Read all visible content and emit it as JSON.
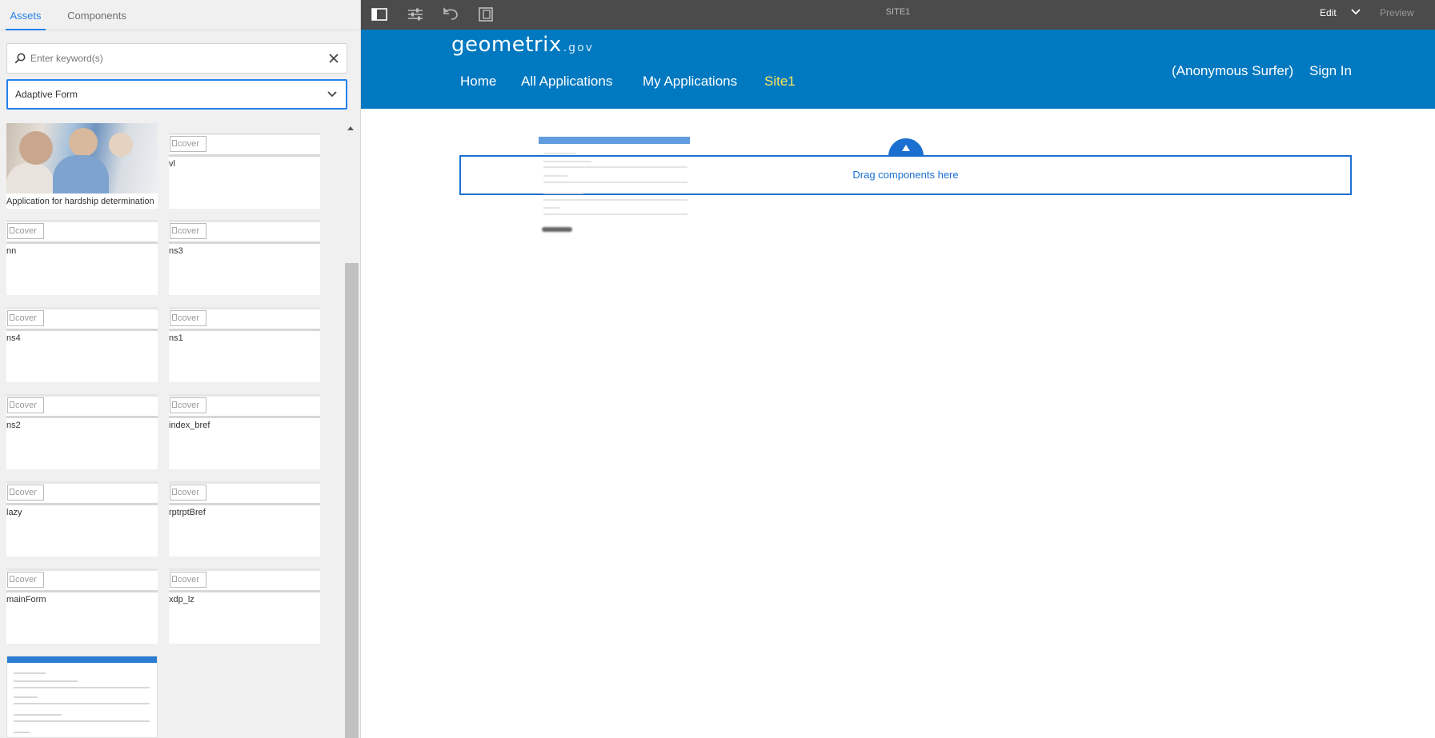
{
  "rail": {
    "tabs": [
      {
        "label": "Assets",
        "active": true
      },
      {
        "label": "Components",
        "active": false
      }
    ],
    "search": {
      "placeholder": "Enter keyword(s)",
      "value": ""
    },
    "filter": {
      "selected": "Adaptive Form"
    },
    "assets": [
      {
        "label": "Application for hardship determination",
        "thumbnail": "photo"
      },
      {
        "label": "vl",
        "cover_alt": "cover"
      },
      {
        "label": "nn",
        "cover_alt": "cover"
      },
      {
        "label": "ns3",
        "cover_alt": "cover"
      },
      {
        "label": "ns4",
        "cover_alt": "cover"
      },
      {
        "label": "ns1",
        "cover_alt": "cover"
      },
      {
        "label": "ns2",
        "cover_alt": "cover"
      },
      {
        "label": "index_bref",
        "cover_alt": "cover"
      },
      {
        "label": "lazy",
        "cover_alt": "cover"
      },
      {
        "label": "rptrptBref",
        "cover_alt": "cover"
      },
      {
        "label": "mainForm",
        "cover_alt": "cover"
      },
      {
        "label": "xdp_lz",
        "cover_alt": "cover"
      }
    ]
  },
  "toolbar": {
    "title": "SITE1",
    "mode": "Edit",
    "preview": "Preview",
    "icons": [
      "toggle-side-panel-icon",
      "page-properties-icon",
      "undo-icon",
      "emulator-icon"
    ]
  },
  "site": {
    "logo": "geometrix",
    "logo_suffix": ".gov",
    "nav": [
      {
        "label": "Home",
        "current": false
      },
      {
        "label": "All Applications",
        "current": false
      },
      {
        "label": "My Applications",
        "current": false
      },
      {
        "label": "Site1",
        "current": true
      }
    ],
    "user": "(Anonymous Surfer)",
    "sign_in": "Sign In"
  },
  "canvas": {
    "drop_text": "Drag components here"
  },
  "colors": {
    "accent": "#2680eb",
    "header_blue": "#0079c1",
    "toolbar_bg": "#4b4b4b",
    "current_nav": "#ffe65a"
  }
}
